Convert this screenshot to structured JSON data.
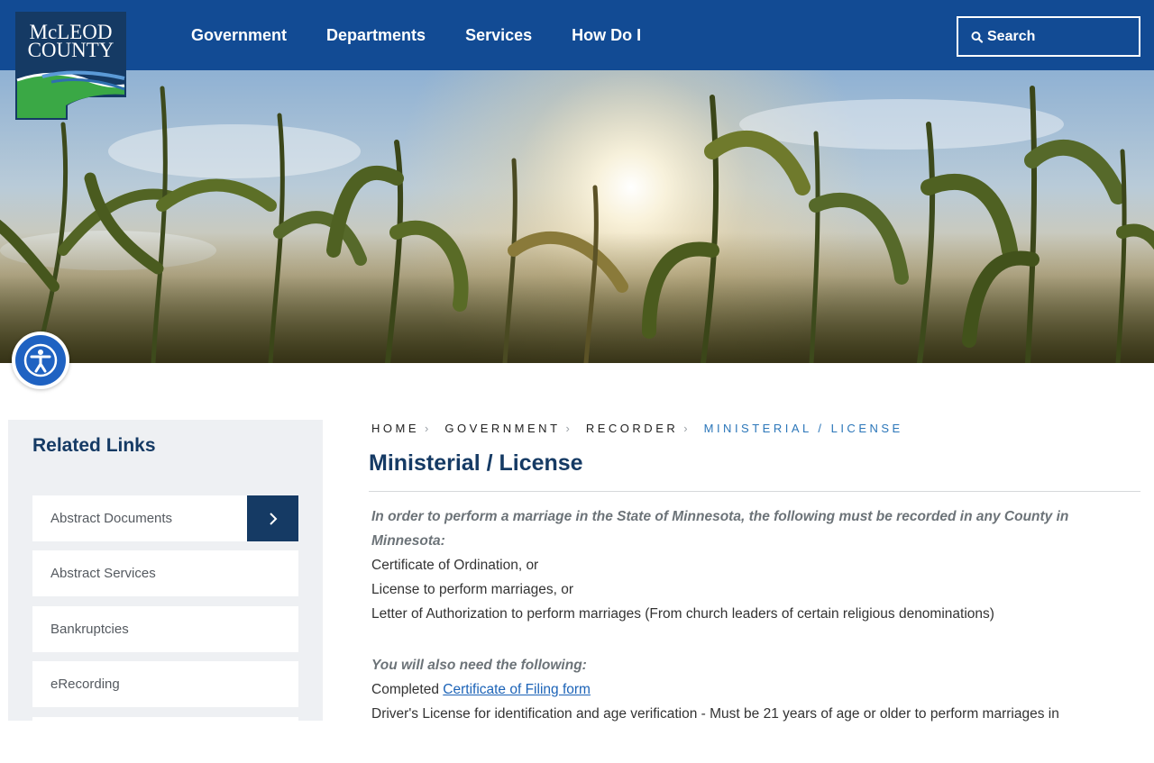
{
  "logo": {
    "line1": "McLEOD",
    "line2": "COUNTY"
  },
  "nav": {
    "items": [
      {
        "label": "Government"
      },
      {
        "label": "Departments"
      },
      {
        "label": "Services"
      },
      {
        "label": "How Do I"
      }
    ]
  },
  "search": {
    "label": "Search",
    "icon": "search-icon"
  },
  "hero": {
    "image": "cornfield-sunset"
  },
  "accessibility": {
    "icon": "accessibility-icon"
  },
  "sidebar": {
    "title": "Related Links",
    "items": [
      {
        "label": "Abstract Documents",
        "icon": "chevron-right-icon"
      },
      {
        "label": "Abstract Services"
      },
      {
        "label": "Bankruptcies"
      },
      {
        "label": "eRecording"
      }
    ]
  },
  "breadcrumb": {
    "items": [
      "HOME",
      "GOVERNMENT",
      "RECORDER"
    ],
    "current": "MINISTERIAL / LICENSE"
  },
  "page": {
    "title": "Ministerial / License",
    "intro": "In order to perform a marriage in the State of Minnesota, the following must be recorded in any County in Minnesota:",
    "docs": [
      "Certificate of Ordination, or",
      "License to perform marriages, or",
      "Letter of Authorization to perform marriages (From church leaders of certain religious denominations)"
    ],
    "also_heading": "You will also need the following:",
    "completed_prefix": "Completed",
    "form_link": "Certificate of Filing form",
    "drivers_license": "Driver's License for identification and age verification - Must be 21 years of age or older to perform marriages in"
  },
  "colors": {
    "header": "#124b94",
    "navy": "#153a64",
    "link": "#1c63b7",
    "breadcrumb_current": "#2b76b9",
    "sidebar_bg": "#eef0f3",
    "accessibility": "#1f62c2"
  }
}
